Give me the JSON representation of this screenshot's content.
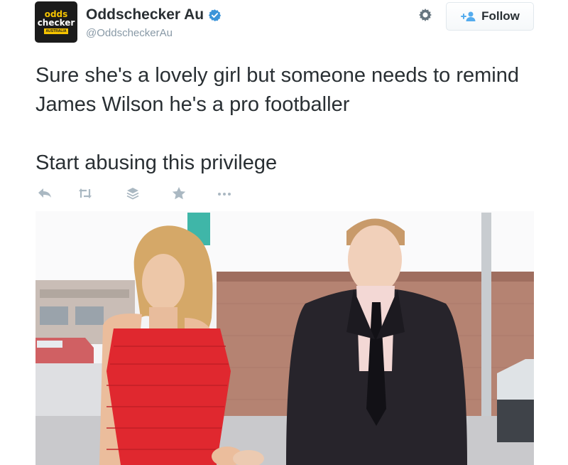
{
  "author": {
    "avatar_line1": "odds",
    "avatar_line2": "checker",
    "avatar_tag": "AUSTRALIA",
    "display_name": "Oddschecker Au",
    "handle": "@OddscheckerAu"
  },
  "header": {
    "follow_label": "Follow"
  },
  "tweet": {
    "paragraph1": "Sure she's a lovely girl but someone needs to remind James Wilson he's a pro footballer",
    "paragraph2": "Start abusing this privilege"
  },
  "actions": [
    {
      "name": "reply-icon"
    },
    {
      "name": "retweet-icon"
    },
    {
      "name": "buffer-icon"
    },
    {
      "name": "favorite-icon"
    },
    {
      "name": "more-icon"
    }
  ],
  "colors": {
    "verified": "#3b94d9",
    "icon_gray": "#aab8c2",
    "text": "#292f33",
    "handle": "#8899a6",
    "brand_yellow": "#f6c400"
  }
}
